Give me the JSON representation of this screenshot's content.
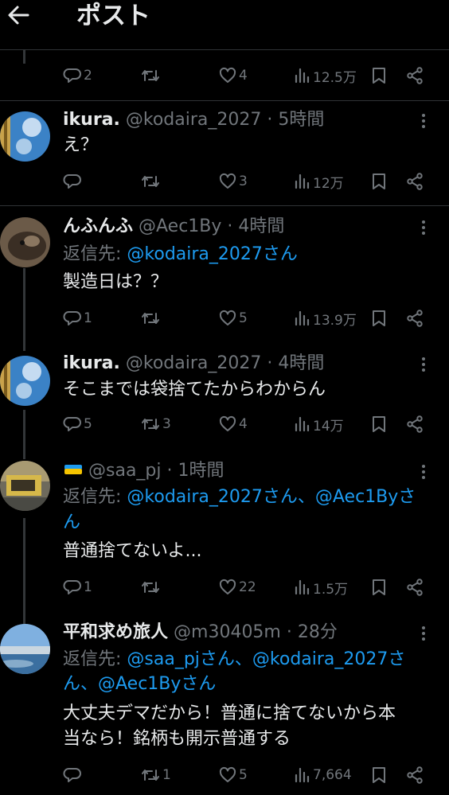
{
  "header": {
    "title": "ポスト"
  },
  "posts": [
    {
      "actions": {
        "replies": "2",
        "reposts": "",
        "likes": "4",
        "views": "12.5万"
      }
    },
    {
      "name": "ikura.",
      "handle": "@kodaira_2027",
      "sep": "·",
      "time": "5時間",
      "text": [
        "え？"
      ],
      "actions": {
        "replies": "",
        "reposts": "",
        "likes": "3",
        "views": "12万"
      }
    },
    {
      "name": "んふんふ",
      "handle": "@Aec1By",
      "sep": "·",
      "time": "4時間",
      "reply_prefix": "返信先: ",
      "reply_to": [
        "@kodaira_2027さん"
      ],
      "text": [
        "製造日は？？"
      ],
      "actions": {
        "replies": "1",
        "reposts": "",
        "likes": "5",
        "views": "13.9万"
      }
    },
    {
      "name": "ikura.",
      "handle": "@kodaira_2027",
      "sep": "·",
      "time": "4時間",
      "text": [
        "そこまでは袋捨てたからわからん"
      ],
      "actions": {
        "replies": "5",
        "reposts": "3",
        "likes": "4",
        "views": "14万"
      }
    },
    {
      "name": "",
      "handle": "@saa_pj",
      "sep": "·",
      "time": "1時間",
      "reply_prefix": "返信先: ",
      "reply_to": [
        "@kodaira_2027さん、@Aec1Byさ",
        "ん"
      ],
      "text": [
        "普通捨てないよ..."
      ],
      "actions": {
        "replies": "1",
        "reposts": "",
        "likes": "22",
        "views": "1.5万"
      }
    },
    {
      "name": "平和求め旅人",
      "handle": "@m30405m",
      "sep": "·",
      "time": "28分",
      "reply_prefix": "返信先: ",
      "reply_to": [
        "@saa_pjさん、@kodaira_2027さ",
        "ん、@Aec1Byさん"
      ],
      "text": [
        "大丈夫デマだから！普通に捨てないから本",
        "当なら！銘柄も開示普通する"
      ],
      "actions": {
        "replies": "",
        "reposts": "1",
        "likes": "5",
        "views": "7,664"
      }
    }
  ],
  "icons": {
    "back": "back-arrow-icon",
    "reply": "reply-icon",
    "repost": "repost-icon",
    "like": "heart-icon",
    "views": "views-icon",
    "bookmark": "bookmark-icon",
    "share": "share-icon",
    "more": "more-icon",
    "sponge_emoji": "sponge-emoji-icon"
  },
  "colors": {
    "background": "#000000",
    "text": "#e7e9ea",
    "muted": "#71767b",
    "link": "#1d9bf0",
    "divider": "#2f3336"
  }
}
